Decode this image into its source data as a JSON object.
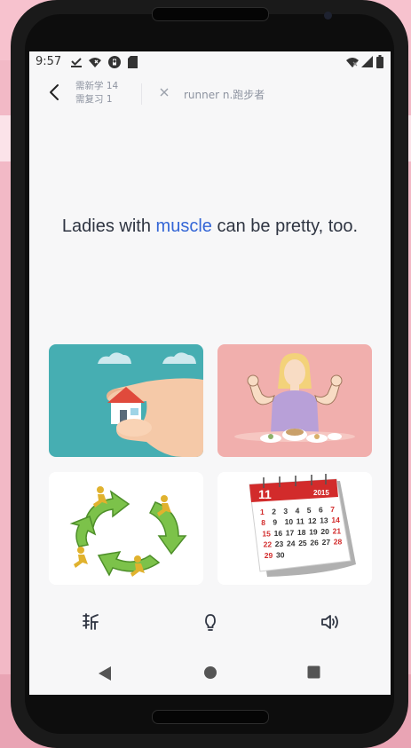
{
  "status_bar": {
    "time": "9:57"
  },
  "header": {
    "new_to_learn": "需新学 14",
    "to_review": "需复习 1",
    "previous_word": "runner n.跑步者"
  },
  "sentence": {
    "before": "Ladies with ",
    "highlight": "muscle",
    "after": " can be pretty, too."
  },
  "options": [
    {
      "name": "house-hand-card"
    },
    {
      "name": "muscle-woman-card"
    },
    {
      "name": "recycle-runners-card"
    },
    {
      "name": "calendar-card"
    }
  ],
  "calendar": {
    "month": "11",
    "year": "2015",
    "days": [
      "1",
      "2",
      "3",
      "4",
      "5",
      "6",
      "7",
      "8",
      "9",
      "10",
      "11",
      "12",
      "13",
      "14",
      "15",
      "16",
      "17",
      "18",
      "19",
      "20",
      "21",
      "22",
      "23",
      "24",
      "25",
      "26",
      "27",
      "28",
      "29",
      "30"
    ]
  },
  "colors": {
    "highlight": "#3466d6",
    "page_background": "#f2b9c6",
    "screen_background": "#f7f7f8"
  },
  "icons": {
    "back": "chevron-left-icon",
    "close": "close-icon",
    "cut": "cut-icon",
    "hint": "lightbulb-icon",
    "sound": "speaker-icon"
  }
}
